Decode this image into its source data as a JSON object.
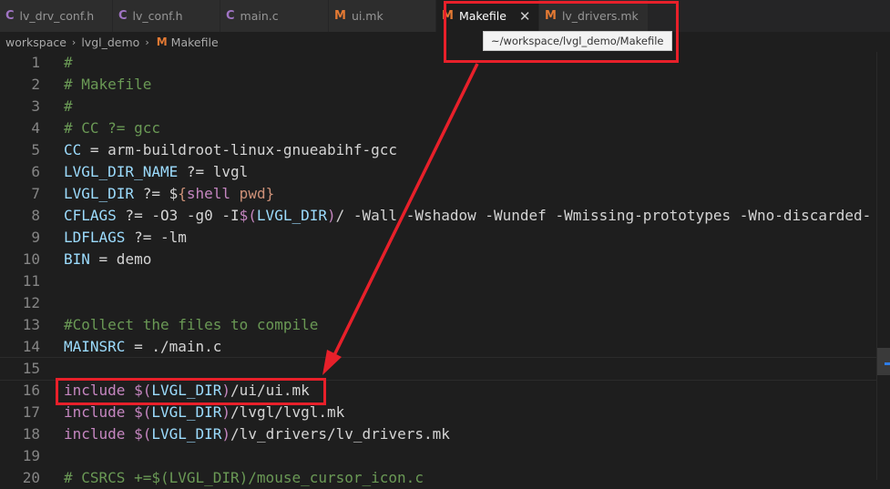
{
  "tabs": [
    {
      "icon": "C",
      "type": "c",
      "label": "lv_drv_conf.h",
      "active": false
    },
    {
      "icon": "C",
      "type": "c",
      "label": "lv_conf.h",
      "active": false
    },
    {
      "icon": "C",
      "type": "c",
      "label": "main.c",
      "active": false
    },
    {
      "icon": "M",
      "type": "m",
      "label": "ui.mk",
      "active": false
    },
    {
      "icon": "M",
      "type": "m",
      "label": "Makefile",
      "active": true,
      "close": "✕"
    },
    {
      "icon": "M",
      "type": "m",
      "label": "lv_drivers.mk",
      "active": false
    }
  ],
  "breadcrumb": {
    "items": [
      "workspace",
      "lvgl_demo"
    ],
    "file_icon": "M",
    "file": "Makefile",
    "sep": "›"
  },
  "tooltip": {
    "text": "~/workspace/lvgl_demo/Makefile"
  },
  "editor": {
    "current_line": 15,
    "lines": [
      {
        "n": "1",
        "tokens": [
          [
            "#",
            "comment"
          ]
        ]
      },
      {
        "n": "2",
        "tokens": [
          [
            "# Makefile",
            "comment"
          ]
        ]
      },
      {
        "n": "3",
        "tokens": [
          [
            "#",
            "comment"
          ]
        ]
      },
      {
        "n": "4",
        "tokens": [
          [
            "# CC ?= gcc",
            "comment"
          ]
        ]
      },
      {
        "n": "5",
        "tokens": [
          [
            "CC",
            "var"
          ],
          [
            " = arm-buildroot-linux-gnueabihf-gcc",
            "plain"
          ]
        ]
      },
      {
        "n": "6",
        "tokens": [
          [
            "LVGL_DIR_NAME",
            "var"
          ],
          [
            " ?= lvgl",
            "plain"
          ]
        ]
      },
      {
        "n": "7",
        "tokens": [
          [
            "LVGL_DIR",
            "var"
          ],
          [
            " ?= ",
            "plain"
          ],
          [
            "$",
            "dollar"
          ],
          [
            "{",
            "str"
          ],
          [
            "shell",
            "kw"
          ],
          [
            " pwd",
            "str"
          ],
          [
            "}",
            "str"
          ]
        ]
      },
      {
        "n": "8",
        "tokens": [
          [
            "CFLAGS",
            "var"
          ],
          [
            " ?= -O3 -g0 -I",
            "plain"
          ],
          [
            "$(",
            "kw"
          ],
          [
            "LVGL_DIR",
            "var"
          ],
          [
            ")",
            "kw"
          ],
          [
            "/ -Wall -Wshadow -Wundef -Wmissing-prototypes -Wno-discarded-",
            "plain"
          ]
        ]
      },
      {
        "n": "9",
        "tokens": [
          [
            "LDFLAGS",
            "var"
          ],
          [
            " ?= -lm",
            "plain"
          ]
        ]
      },
      {
        "n": "10",
        "tokens": [
          [
            "BIN",
            "var"
          ],
          [
            " = demo",
            "plain"
          ]
        ]
      },
      {
        "n": "11",
        "tokens": []
      },
      {
        "n": "12",
        "tokens": []
      },
      {
        "n": "13",
        "tokens": [
          [
            "#Collect the files to compile",
            "comment"
          ]
        ]
      },
      {
        "n": "14",
        "tokens": [
          [
            "MAINSRC",
            "var"
          ],
          [
            " = ./main.c",
            "plain"
          ]
        ]
      },
      {
        "n": "15",
        "tokens": []
      },
      {
        "n": "16",
        "tokens": [
          [
            "include",
            "kw"
          ],
          [
            " ",
            "plain"
          ],
          [
            "$(",
            "kw"
          ],
          [
            "LVGL_DIR",
            "var"
          ],
          [
            ")",
            "kw"
          ],
          [
            "/ui/ui.mk",
            "plain"
          ]
        ]
      },
      {
        "n": "17",
        "tokens": [
          [
            "include",
            "kw"
          ],
          [
            " ",
            "plain"
          ],
          [
            "$(",
            "kw"
          ],
          [
            "LVGL_DIR",
            "var"
          ],
          [
            ")",
            "kw"
          ],
          [
            "/lvgl/lvgl.mk",
            "plain"
          ]
        ]
      },
      {
        "n": "18",
        "tokens": [
          [
            "include",
            "kw"
          ],
          [
            " ",
            "plain"
          ],
          [
            "$(",
            "kw"
          ],
          [
            "LVGL_DIR",
            "var"
          ],
          [
            ")",
            "kw"
          ],
          [
            "/lv_drivers/lv_drivers.mk",
            "plain"
          ]
        ]
      },
      {
        "n": "19",
        "tokens": []
      },
      {
        "n": "20",
        "tokens": [
          [
            "# CSRCS +=$(LVGL_DIR)/mouse_cursor_icon.c",
            "comment"
          ]
        ]
      }
    ]
  },
  "annotation": {
    "color": "#e8202a",
    "arrow_from": "makefile-tab",
    "arrow_to": "line-16"
  },
  "colors": {
    "background": "#1e1e1e",
    "comment": "#6a9955",
    "variable": "#9cdcfe",
    "keyword": "#c586c0"
  }
}
